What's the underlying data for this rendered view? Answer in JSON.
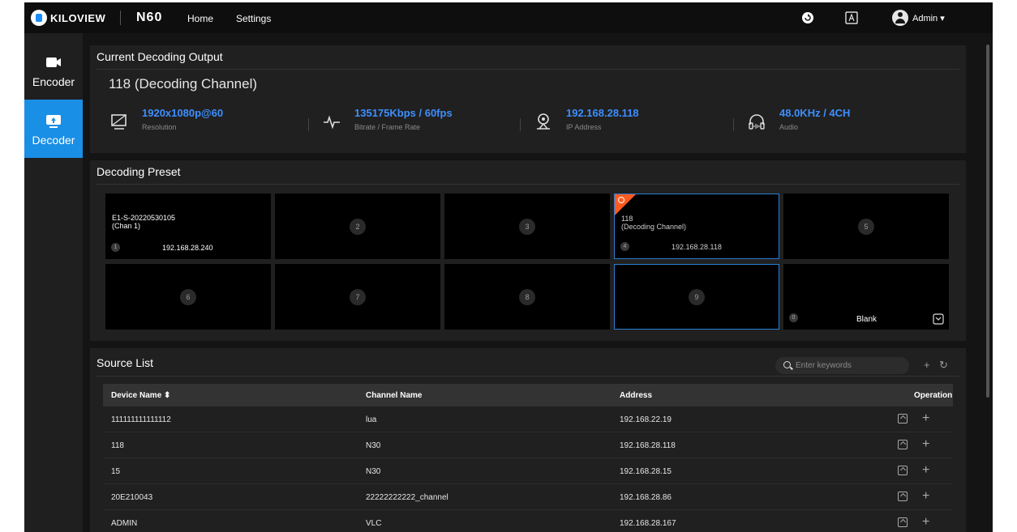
{
  "topbar": {
    "brand": "KILOVIEW",
    "model": "N60",
    "nav": [
      "Home",
      "Settings"
    ],
    "icons": [
      "refresh-icon",
      "language-icon",
      "user-avatar-icon"
    ],
    "user": "Admin"
  },
  "sidebar": {
    "items": [
      {
        "label": "Encoder",
        "icon": "camera-icon",
        "active": false
      },
      {
        "label": "Decoder",
        "icon": "monitor-upload-icon",
        "active": true
      }
    ]
  },
  "current_output": {
    "title": "Current Decoding Output",
    "channel": "118 (Decoding Channel)",
    "stats": [
      {
        "value": "1920x1080p@60",
        "label": "Resolution",
        "icon": "display-icon"
      },
      {
        "value": "135175Kbps / 60fps",
        "label": "Bitrate / Frame Rate",
        "icon": "waveform-icon"
      },
      {
        "value": "192.168.28.118",
        "label": "IP Address",
        "icon": "location-pin-icon"
      },
      {
        "value": "48.0KHz / 4CH",
        "label": "Audio",
        "icon": "headphones-icon"
      }
    ]
  },
  "preset": {
    "title": "Decoding Preset",
    "tiles": [
      {
        "num": "1",
        "name": "E1-S-20220530105\n(Chan 1)",
        "addr": "192.168.28.240"
      },
      {
        "num": "2"
      },
      {
        "num": "3"
      },
      {
        "num": "4",
        "name": "118\n(Decoding Channel)",
        "addr": "192.168.28.118",
        "active": true
      },
      {
        "num": "5"
      },
      {
        "num": "6"
      },
      {
        "num": "7"
      },
      {
        "num": "8"
      },
      {
        "num": "9",
        "selected": true
      },
      {
        "num": "0",
        "blank": "Blank"
      }
    ]
  },
  "source_list": {
    "title": "Source List",
    "search_placeholder": "Enter keywords",
    "headers": [
      "Device Name",
      "Channel Name",
      "Address",
      "Operation"
    ],
    "rows": [
      [
        "111111111111112",
        "lua",
        "192.168.22.19"
      ],
      [
        "118",
        "N30",
        "192.168.28.118"
      ],
      [
        "15",
        "N30",
        "192.168.28.15"
      ],
      [
        "20E210043",
        "22222222222_channel",
        "192.168.28.86"
      ],
      [
        "ADMIN",
        "VLC",
        "192.168.28.167"
      ]
    ]
  },
  "colors": {
    "accent": "#1a8fe6",
    "value_blue": "#3d8fff",
    "active_corner": "#ff5a1f"
  }
}
